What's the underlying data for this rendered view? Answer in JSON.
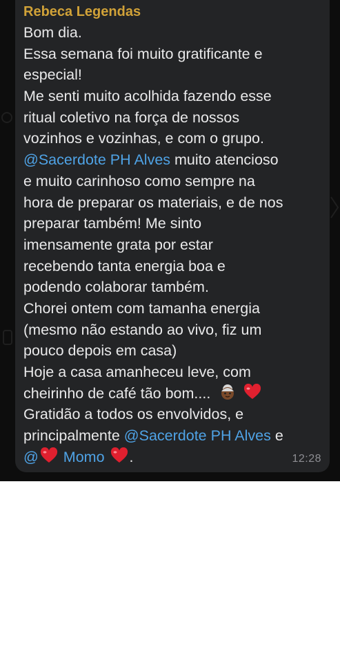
{
  "message": {
    "sender": "Rebeca Legendas",
    "lines": [
      "Bom dia.",
      "Essa semana foi muito gratificante e",
      "especial!",
      "Me senti muito acolhida fazendo esse",
      "ritual coletivo na força de nossos",
      "vozinhos e vozinhas, e com o grupo."
    ],
    "line7_mention": "@Sacerdote PH Alves",
    "line7_rest": " muito atencioso",
    "lines_b": [
      "e muito carinhoso como sempre na",
      "hora de preparar os materiais, e de nos",
      "preparar também!  Me sinto",
      "imensamente grata por estar",
      "recebendo tanta energia boa e",
      "podendo colaborar também.",
      "Chorei ontem com tamanha energia",
      "(mesmo não estando ao vivo, fiz um",
      "pouco depois em casa)",
      "Hoje a casa amanheceu leve, com"
    ],
    "line17_text": "cheirinho de café tão bom....",
    "line18": "Gratidão a todos os envolvidos, e",
    "line19_prefix": "principalmente ",
    "line19_mention": "@Sacerdote PH Alves",
    "line19_suffix": " e",
    "line20_at": "@",
    "line20_mention": " Momo ",
    "line20_suffix": ".",
    "time": "12:28",
    "emojis": [
      "old-woman-emoji",
      "red-heart-emoji"
    ],
    "colors": {
      "sender": "#d1a238",
      "mention": "#4fa3e6",
      "text": "#e9e9ea",
      "bubble": "#232426",
      "time": "#8e8e93",
      "heart": "#e0202f"
    }
  }
}
